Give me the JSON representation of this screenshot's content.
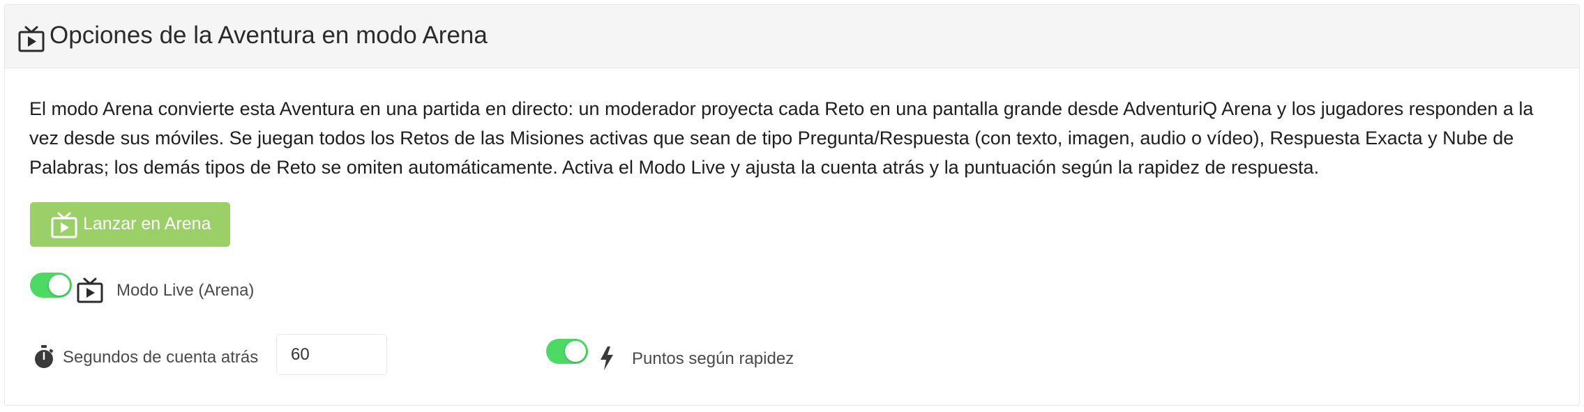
{
  "header": {
    "icon": "tv-play-icon",
    "title": "Opciones de la Aventura en modo Arena"
  },
  "description": "El modo Arena convierte esta Aventura en una partida en directo: un moderador proyecta cada Reto en una pantalla grande desde AdventuriQ Arena y los jugadores responden a la vez desde sus móviles. Se juegan todos los Retos de las Misiones activas que sean de tipo Pregunta/Respuesta (con texto, imagen, audio o vídeo), Respuesta Exacta y Nube de Palabras; los demás tipos de Reto se omiten automáticamente. Activa el Modo Live y ajusta la cuenta atrás y la puntuación según la rapidez de respuesta.",
  "launch_button": {
    "icon": "tv-play-icon",
    "label": "Lanzar en Arena",
    "color": "#9bd069"
  },
  "live_mode": {
    "enabled": true,
    "icon": "tv-play-icon",
    "label": "Modo Live (Arena)"
  },
  "countdown": {
    "icon": "stopwatch-icon",
    "label": "Segundos de cuenta atrás",
    "value": "60"
  },
  "speed_points": {
    "enabled": true,
    "icon": "bolt-icon",
    "label": "Puntos según rapidez"
  },
  "colors": {
    "toggle_on": "#4cd964",
    "header_bg": "#f5f5f5"
  }
}
